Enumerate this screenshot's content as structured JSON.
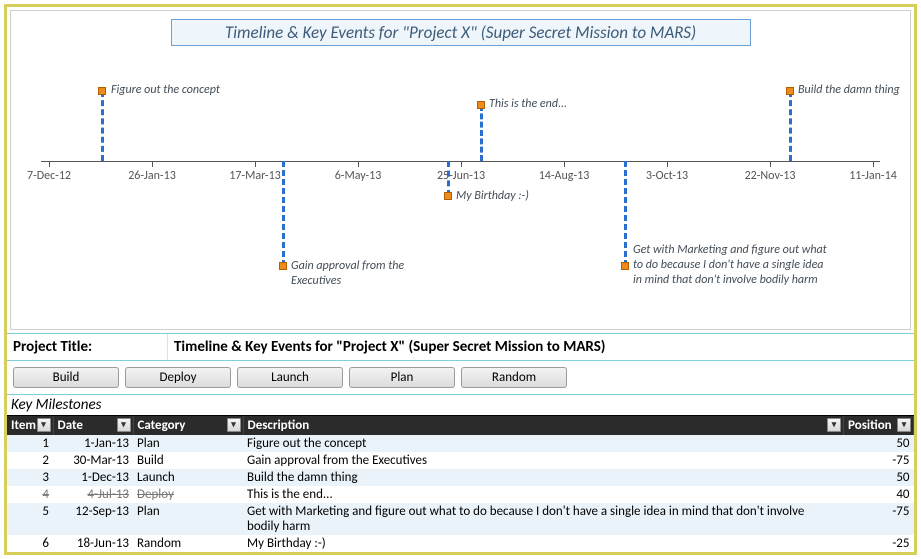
{
  "chart_title": "Timeline & Key Events for \"Project X\" (Super Secret Mission to MARS)",
  "project_title_label": "Project Title:",
  "project_title_value": "Timeline & Key Events for \"Project X\" (Super Secret Mission to MARS)",
  "buttons": [
    "Build",
    "Deploy",
    "Launch",
    "Plan",
    "Random"
  ],
  "axis": {
    "ticks": [
      "7-Dec-12",
      "26-Jan-13",
      "17-Mar-13",
      "6-May-13",
      "25-Jun-13",
      "14-Aug-13",
      "3-Oct-13",
      "22-Nov-13",
      "11-Jan-14"
    ]
  },
  "milestones_title": "Key Milestones",
  "table": {
    "headers": [
      "Item",
      "Date",
      "Category",
      "Description",
      "Position"
    ],
    "rows": [
      {
        "item": 1,
        "date": "1-Jan-13",
        "category": "Plan",
        "description": "Figure out the concept",
        "position": 50
      },
      {
        "item": 2,
        "date": "30-Mar-13",
        "category": "Build",
        "description": "Gain approval from the Executives",
        "position": -75
      },
      {
        "item": 3,
        "date": "1-Dec-13",
        "category": "Launch",
        "description": "Build the damn thing",
        "position": 50
      },
      {
        "item": 4,
        "date": "4-Jul-13",
        "category": "Deploy",
        "description": "This is the end...",
        "position": 40,
        "strike": true
      },
      {
        "item": 5,
        "date": "12-Sep-13",
        "category": "Plan",
        "description": "Get with Marketing and figure out what to do because I don't have a single idea in mind that don't involve bodily harm",
        "position": -75
      },
      {
        "item": 6,
        "date": "18-Jun-13",
        "category": "Random",
        "description": "My Birthday :-)",
        "position": -25
      }
    ]
  },
  "chart_data": {
    "type": "timeline",
    "title": "Timeline & Key Events for \"Project X\" (Super Secret Mission to MARS)",
    "x_axis_ticks": [
      "7-Dec-12",
      "26-Jan-13",
      "17-Mar-13",
      "6-May-13",
      "25-Jun-13",
      "14-Aug-13",
      "3-Oct-13",
      "22-Nov-13",
      "11-Jan-14"
    ],
    "events": [
      {
        "date": "1-Jan-13",
        "label": "Figure out the concept",
        "offset": 50
      },
      {
        "date": "30-Mar-13",
        "label": "Gain approval from the Executives",
        "offset": -75
      },
      {
        "date": "18-Jun-13",
        "label": "My Birthday :-)",
        "offset": -25
      },
      {
        "date": "4-Jul-13",
        "label": "This is the end...",
        "offset": 40
      },
      {
        "date": "12-Sep-13",
        "label": "Get with Marketing and figure out what to do because I don't have a single idea in mind that don't involve bodily harm",
        "offset": -75
      },
      {
        "date": "1-Dec-13",
        "label": "Build the damn thing",
        "offset": 50
      }
    ]
  }
}
